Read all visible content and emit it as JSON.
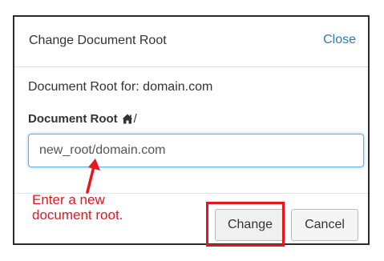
{
  "dialog": {
    "title": "Change Document Root",
    "close_label": "Close",
    "for_text": "Document Root for: domain.com",
    "field_label": "Document Root",
    "field_suffix": "/",
    "input_value": "new_root/domain.com",
    "change_label": "Change",
    "cancel_label": "Cancel"
  },
  "annotation": {
    "line1": "Enter a new",
    "line2": "document root."
  },
  "icons": {
    "home": "home-icon"
  },
  "colors": {
    "link": "#2a7ab8",
    "annotation": "#e8161c",
    "focus": "#66afe9"
  }
}
